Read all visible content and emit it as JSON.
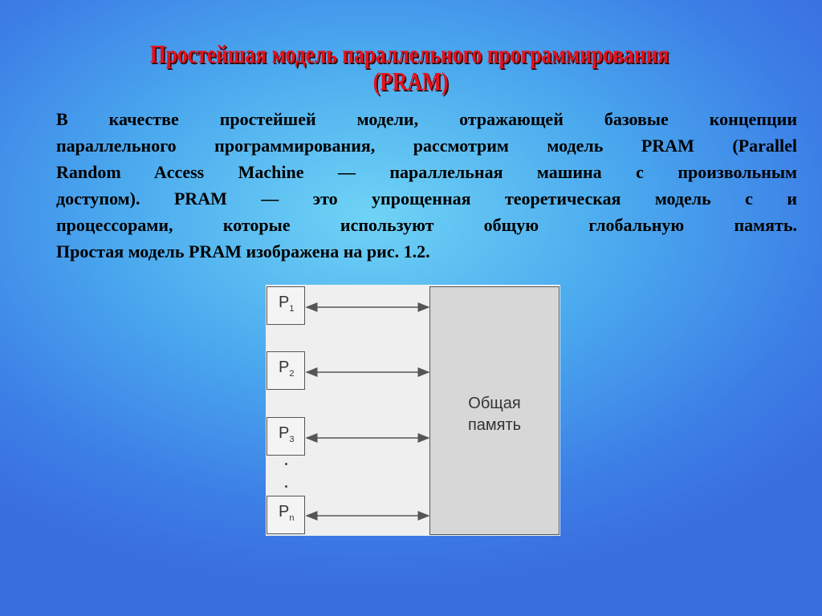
{
  "slide": {
    "title_line1": "Простейшая модель параллельного программирования",
    "title_line2": "(PRAM)",
    "body_lines": [
      "В качестве простейшей модели, отражающей базовые концепции",
      "параллельного программирования, рассмотрим модель PRAM (Parallel",
      "Random Access Machine — параллельная машина с произвольным",
      "доступом). PRAM — это упрощенная теоретическая модель с и",
      "процессорами, которые используют общую глобальную память.",
      "Простая модель PRAM изображена на рис. 1.2."
    ]
  },
  "figure": {
    "processors": [
      {
        "label": "P",
        "sub": "1"
      },
      {
        "label": "P",
        "sub": "2"
      },
      {
        "label": "P",
        "sub": "3"
      },
      {
        "label": "P",
        "sub": "n"
      }
    ],
    "memory_line1": "Общая",
    "memory_line2": "память"
  },
  "colors": {
    "title": "#e8101a",
    "background": "#4aa8ee"
  }
}
